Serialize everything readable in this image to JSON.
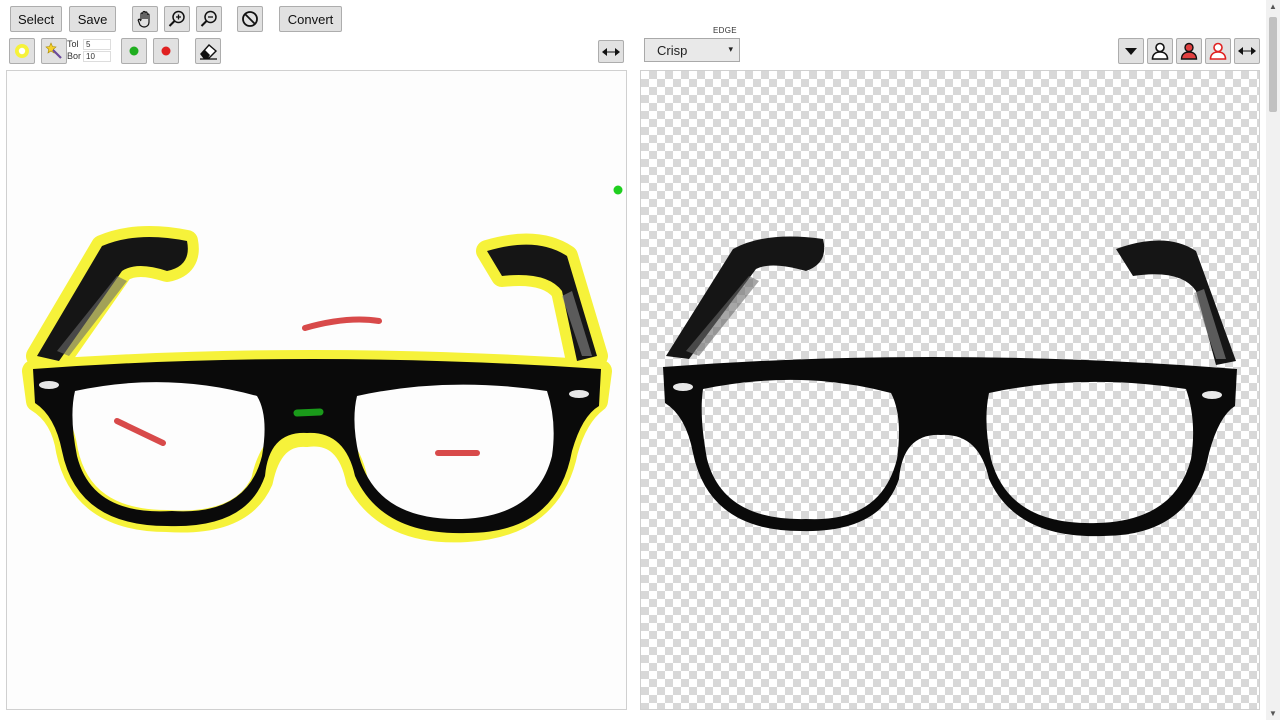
{
  "toolbar": {
    "select_label": "Select",
    "save_label": "Save",
    "convert_label": "Convert",
    "tol_label": "Tol",
    "tol_value": "5",
    "bor_label": "Bor",
    "bor_value": "10",
    "edge_label": "EDGE",
    "edge_value": "Crisp"
  },
  "icons": {
    "pan": "hand-icon",
    "zoom_in": "zoom-in-icon",
    "zoom_out": "zoom-out-icon",
    "cancel": "cancel-icon",
    "highlight": "highlight-circle-icon",
    "magic_wand": "magic-wand-icon",
    "keep_marker": "green-dot-icon",
    "remove_marker": "red-dot-icon",
    "eraser": "eraser-icon",
    "swap": "swap-arrows-icon",
    "dropdown": "dropdown-icon",
    "person_black": "person-icon",
    "person_red_filled": "person-red-filled-icon",
    "person_red_outline": "person-red-outline-icon"
  },
  "colors": {
    "highlight": "#f6f23a",
    "keep": "#1a9a1a",
    "remove": "#d23c3c",
    "frame": "#0a0a0a"
  }
}
